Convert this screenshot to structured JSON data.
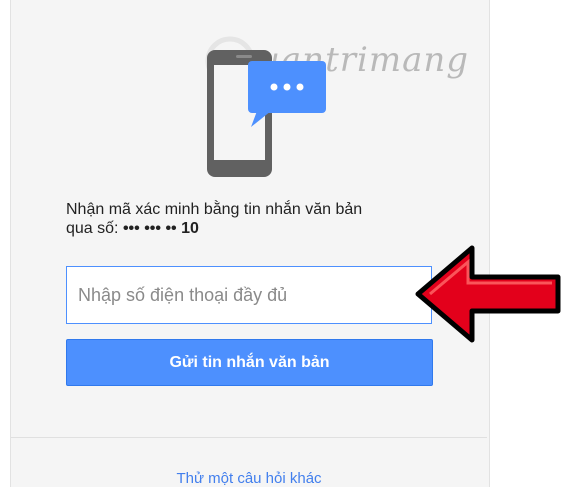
{
  "prompt": {
    "line1": "Nhận mã xác minh bằng tin nhắn văn bản",
    "line2_prefix": "qua số: ",
    "masked_number": "••• ••• •• 10"
  },
  "phone_input": {
    "value": "",
    "placeholder": "Nhập số điện thoại đầy đủ"
  },
  "send_button": {
    "label": "Gửi tin nhắn văn bản"
  },
  "alt_link": {
    "label": "Thử một câu hỏi khác"
  },
  "watermark": {
    "text": "uantrimang"
  },
  "icons": {
    "illustration": "phone-sms-icon",
    "arrow": "red-arrow-icon"
  },
  "colors": {
    "accent": "#4d90fe",
    "arrow": "#e3001b",
    "link": "#427fed"
  }
}
